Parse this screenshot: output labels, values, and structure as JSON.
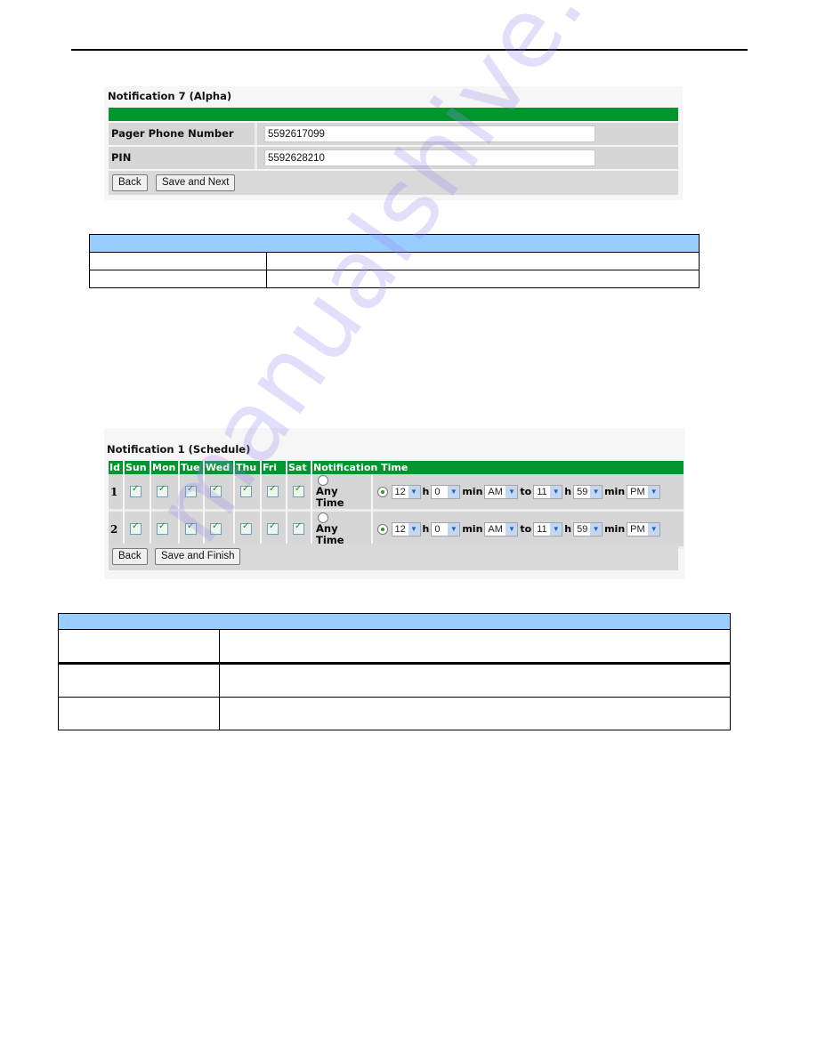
{
  "alpha_panel": {
    "title": "Notification 7 (Alpha)",
    "fields": [
      {
        "label": "Pager Phone Number",
        "value": "5592617099"
      },
      {
        "label": "PIN",
        "value": "5592628210"
      }
    ],
    "buttons": {
      "back": "Back",
      "next": "Save and Next"
    }
  },
  "schedule_panel": {
    "title": "Notification 1 (Schedule)",
    "columns": [
      "Id",
      "Sun",
      "Mon",
      "Tue",
      "Wed",
      "Thu",
      "Fri",
      "Sat",
      "Notification Time"
    ],
    "rows": [
      {
        "id": "1",
        "days": [
          true,
          true,
          true,
          true,
          true,
          true,
          true
        ],
        "any_time_label": "Any Time",
        "any_time_selected": false,
        "range_selected": true,
        "from_hour": "12",
        "from_min": "0",
        "from_ampm": "AM",
        "to_hour": "11",
        "to_min": "59",
        "to_ampm": "PM"
      },
      {
        "id": "2",
        "days": [
          true,
          true,
          true,
          true,
          true,
          true,
          true
        ],
        "any_time_label": "Any Time",
        "any_time_selected": false,
        "range_selected": true,
        "from_hour": "12",
        "from_min": "0",
        "from_ampm": "AM",
        "to_hour": "11",
        "to_min": "59",
        "to_ampm": "PM"
      }
    ],
    "unit_labels": {
      "hour": "h",
      "minute": "min",
      "to": "to"
    },
    "buttons": {
      "back": "Back",
      "finish": "Save and Finish"
    }
  },
  "icons": {
    "dropdown": "chevron-down-icon",
    "checkbox": "checkbox-checked-icon",
    "radio": "radio-icon"
  },
  "colors": {
    "green_header": "#00962e",
    "table_header_blue": "#99ccff",
    "row_gray": "#d6d6d6"
  },
  "watermark": "manualshive.com"
}
